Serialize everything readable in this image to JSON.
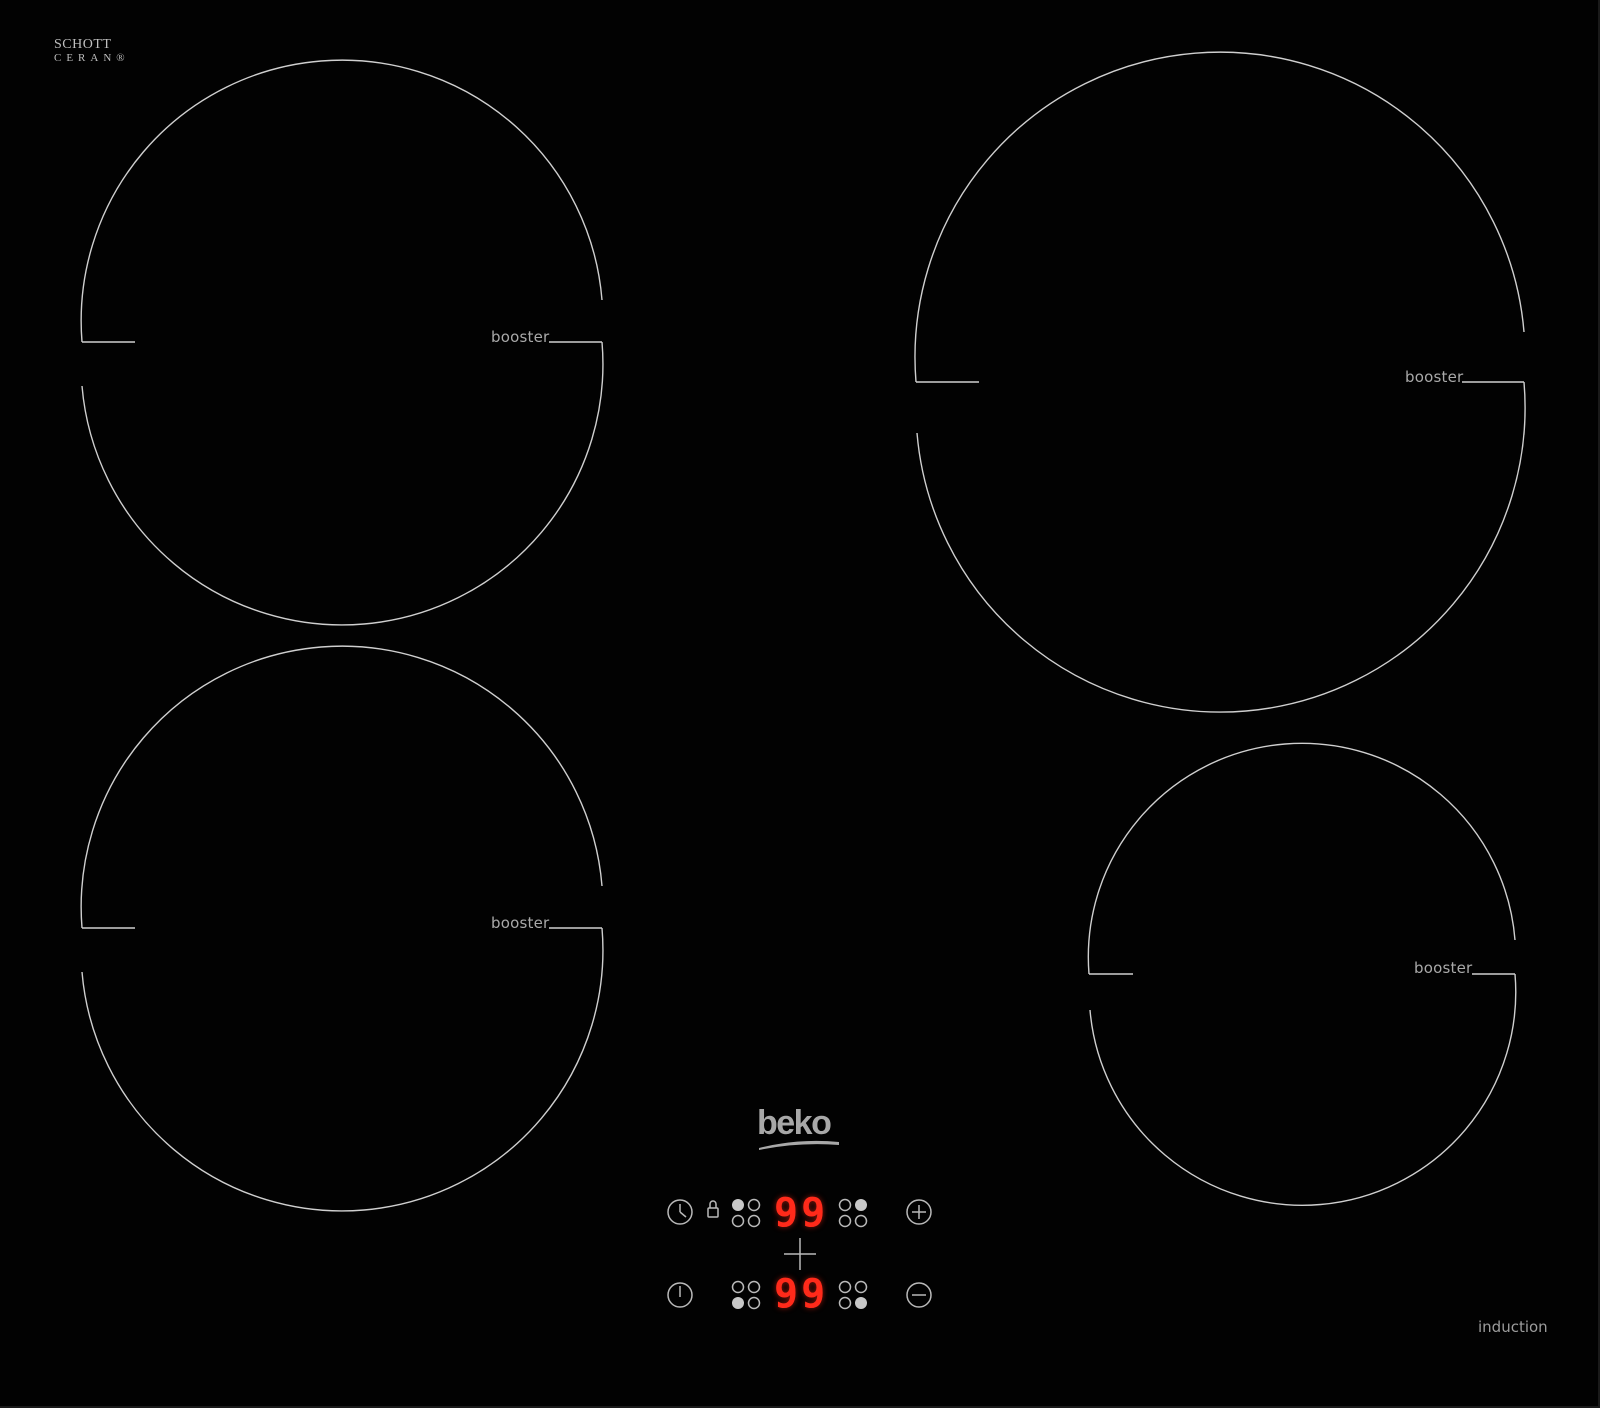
{
  "brand": {
    "logo_text": "beko",
    "glass_brand_line1": "SCHOTT",
    "glass_brand_line2": "CERAN®"
  },
  "zones": [
    {
      "id": "front-left-top",
      "label": "booster"
    },
    {
      "id": "front-left-bottom",
      "label": "booster"
    },
    {
      "id": "right-top",
      "label": "booster"
    },
    {
      "id": "right-bottom",
      "label": "booster"
    }
  ],
  "control_panel": {
    "display_top": "99",
    "display_bottom": "99",
    "icons": [
      "clock-icon",
      "lock-icon",
      "power-icon",
      "plus-icon",
      "minus-icon",
      "bridge-plus-icon"
    ]
  },
  "footer_label": "induction",
  "colors": {
    "glass": "#020202",
    "outline": "#cfcfcf",
    "display_red": "#ff2a1a",
    "label_grey": "#a9a9a9"
  }
}
